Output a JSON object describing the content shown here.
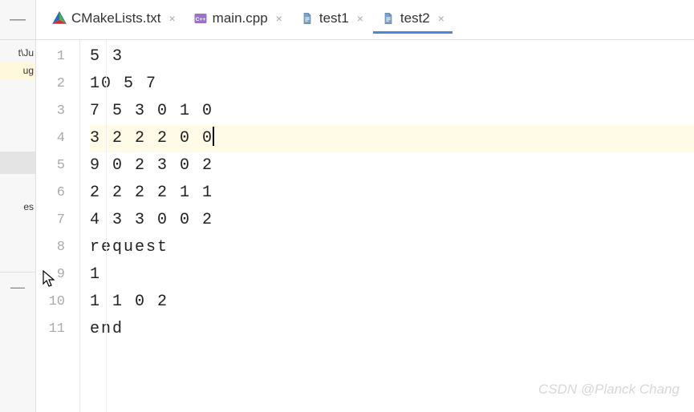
{
  "sidebar": {
    "items": [
      "t\\Ju",
      "ug",
      "",
      "",
      "",
      "es"
    ]
  },
  "tabs": [
    {
      "label": "CMakeLists.txt",
      "icon": "cmake-icon",
      "active": false
    },
    {
      "label": "main.cpp",
      "icon": "cpp-icon",
      "active": false
    },
    {
      "label": "test1",
      "icon": "file-icon",
      "active": false
    },
    {
      "label": "test2",
      "icon": "file-icon",
      "active": true
    }
  ],
  "editor": {
    "lines": [
      "5 3",
      "10 5 7",
      "7 5 3 0 1 0",
      "3 2 2 2 0 0",
      "9 0 2 3 0 2",
      "2 2 2 2 1 1",
      "4 3 3 0 0 2",
      "request",
      "1",
      "1 1 0 2",
      "end"
    ],
    "current_line_index": 3,
    "caret_after_line_index": 3
  },
  "watermark": "CSDN @Planck Chang"
}
